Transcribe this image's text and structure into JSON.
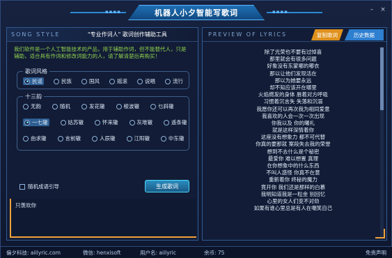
{
  "app": {
    "title": "机器人小夕智能写歌词"
  },
  "left": {
    "header_en": "SONG STYLE",
    "header_cn": "\"专业作词人\" 歌词创作辅助工具",
    "intro": "我们软件是一个人工智能技术的产品，用于辅助作词，但不能替代人，只是辅助，适合具有作词和修改词能力的人，请了解清楚后再购买！",
    "style_group": {
      "legend": "歌词风格",
      "options": [
        "民谣",
        "民族",
        "国风",
        "摇滚",
        "说唱",
        "流行"
      ],
      "selected": "民谣"
    },
    "rhyme_group": {
      "legend": "十三韵",
      "rows": [
        [
          "无韵",
          "随机",
          "发花辙",
          "梭波辙",
          "乜斜辙"
        ],
        [
          "一七辙",
          "姑苏辙",
          "怀来辙",
          "灰堆辙",
          "遥条辙"
        ],
        [
          "由求辙",
          "言前辙",
          "人辰辙",
          "江阳辙",
          "中东辙"
        ]
      ],
      "selected": "一七辙"
    },
    "random_checkbox": "随机成语引导",
    "generate_button": "生成歌词",
    "input_text": "只羡欢你"
  },
  "right": {
    "header_en": "PREVIEW OF LYRICS",
    "tab_create": "复制歌词",
    "tab_history": "历史数据",
    "lyrics": [
      "除了光荣也不要有过悼喜",
      "那里就会有很多问题",
      "好象没有东蒙哪的嘟衣",
      "那以让他们发现活在",
      "那以为她要永远",
      "却不知应该开在哪里",
      "火焰燃发的身体 唇着对方呼吸",
      "习惯着沉言失 失落和沉溺",
      "我愿你还可以再次我为相同爱意",
      "我喜欢的人会一次一次出现",
      "你我以及 你的曙礼",
      "就是这样深情着你",
      "这座没有想象力 都不可代替",
      "你真的要那就 案段失去我的荣誉",
      "想到不去什么是个秘密",
      "最爱你 难以想置 真理",
      "在你想象中的什么东西",
      "不叫人惑怪 你真不在意",
      "重新着你 终秘的魔力",
      "竟开你 我们还是那样的白慕",
      "我明知道我是一粒金 别回忆",
      "心里的女人们变不对劲",
      "如果有谁心里总是有人在嘲笑自己"
    ]
  },
  "footer": {
    "brand": "偏夕科技: aiilyric.com",
    "wechat": "微信: henxisoft",
    "username": "用户名: aiilyric",
    "balance": "余币: 75",
    "disclaimer": "免责声明"
  },
  "colors": {
    "accent_orange": "#f1a23a",
    "accent_blue": "#2e7fd0",
    "intro_green": "#8fd14f"
  }
}
